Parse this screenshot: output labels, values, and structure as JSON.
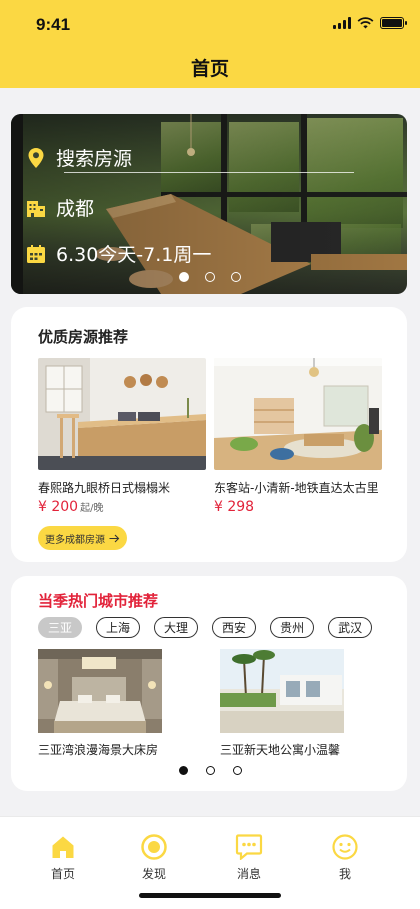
{
  "status_bar": {
    "time": "9:41"
  },
  "header": {
    "title": "首页"
  },
  "banner": {
    "search_label": "搜索房源",
    "city": "成都",
    "dates": "6.30今天-7.1周一",
    "active_slide": 1,
    "slide_count": 3
  },
  "recommend": {
    "title": "优质房源推荐",
    "listings": [
      {
        "name": "春熙路九眼桥日式榻榻米",
        "price": "¥ 200",
        "unit": "起/晚"
      },
      {
        "name": "东客站-小清新-地铁直达太古里",
        "price": "¥ 298",
        "unit": ""
      }
    ],
    "more_button": "更多成都房源"
  },
  "hot_cities": {
    "title": "当季热门城市推荐",
    "cities": [
      "三亚",
      "上海",
      "大理",
      "西安",
      "贵州",
      "武汉"
    ],
    "selected_city": "三亚",
    "listings": [
      {
        "name": "三亚湾浪漫海景大床房"
      },
      {
        "name": "三亚新天地公寓小温馨"
      }
    ],
    "active_page": 1,
    "page_count": 3
  },
  "tabbar": {
    "items": [
      {
        "label": "首页",
        "icon": "home-icon",
        "active": true
      },
      {
        "label": "发现",
        "icon": "discover-icon",
        "active": false
      },
      {
        "label": "消息",
        "icon": "message-icon",
        "active": false
      },
      {
        "label": "我",
        "icon": "profile-icon",
        "active": false
      }
    ]
  },
  "colors": {
    "brand_yellow": "#fbd843",
    "price_red": "#e2233a",
    "text_dark": "#222222"
  }
}
